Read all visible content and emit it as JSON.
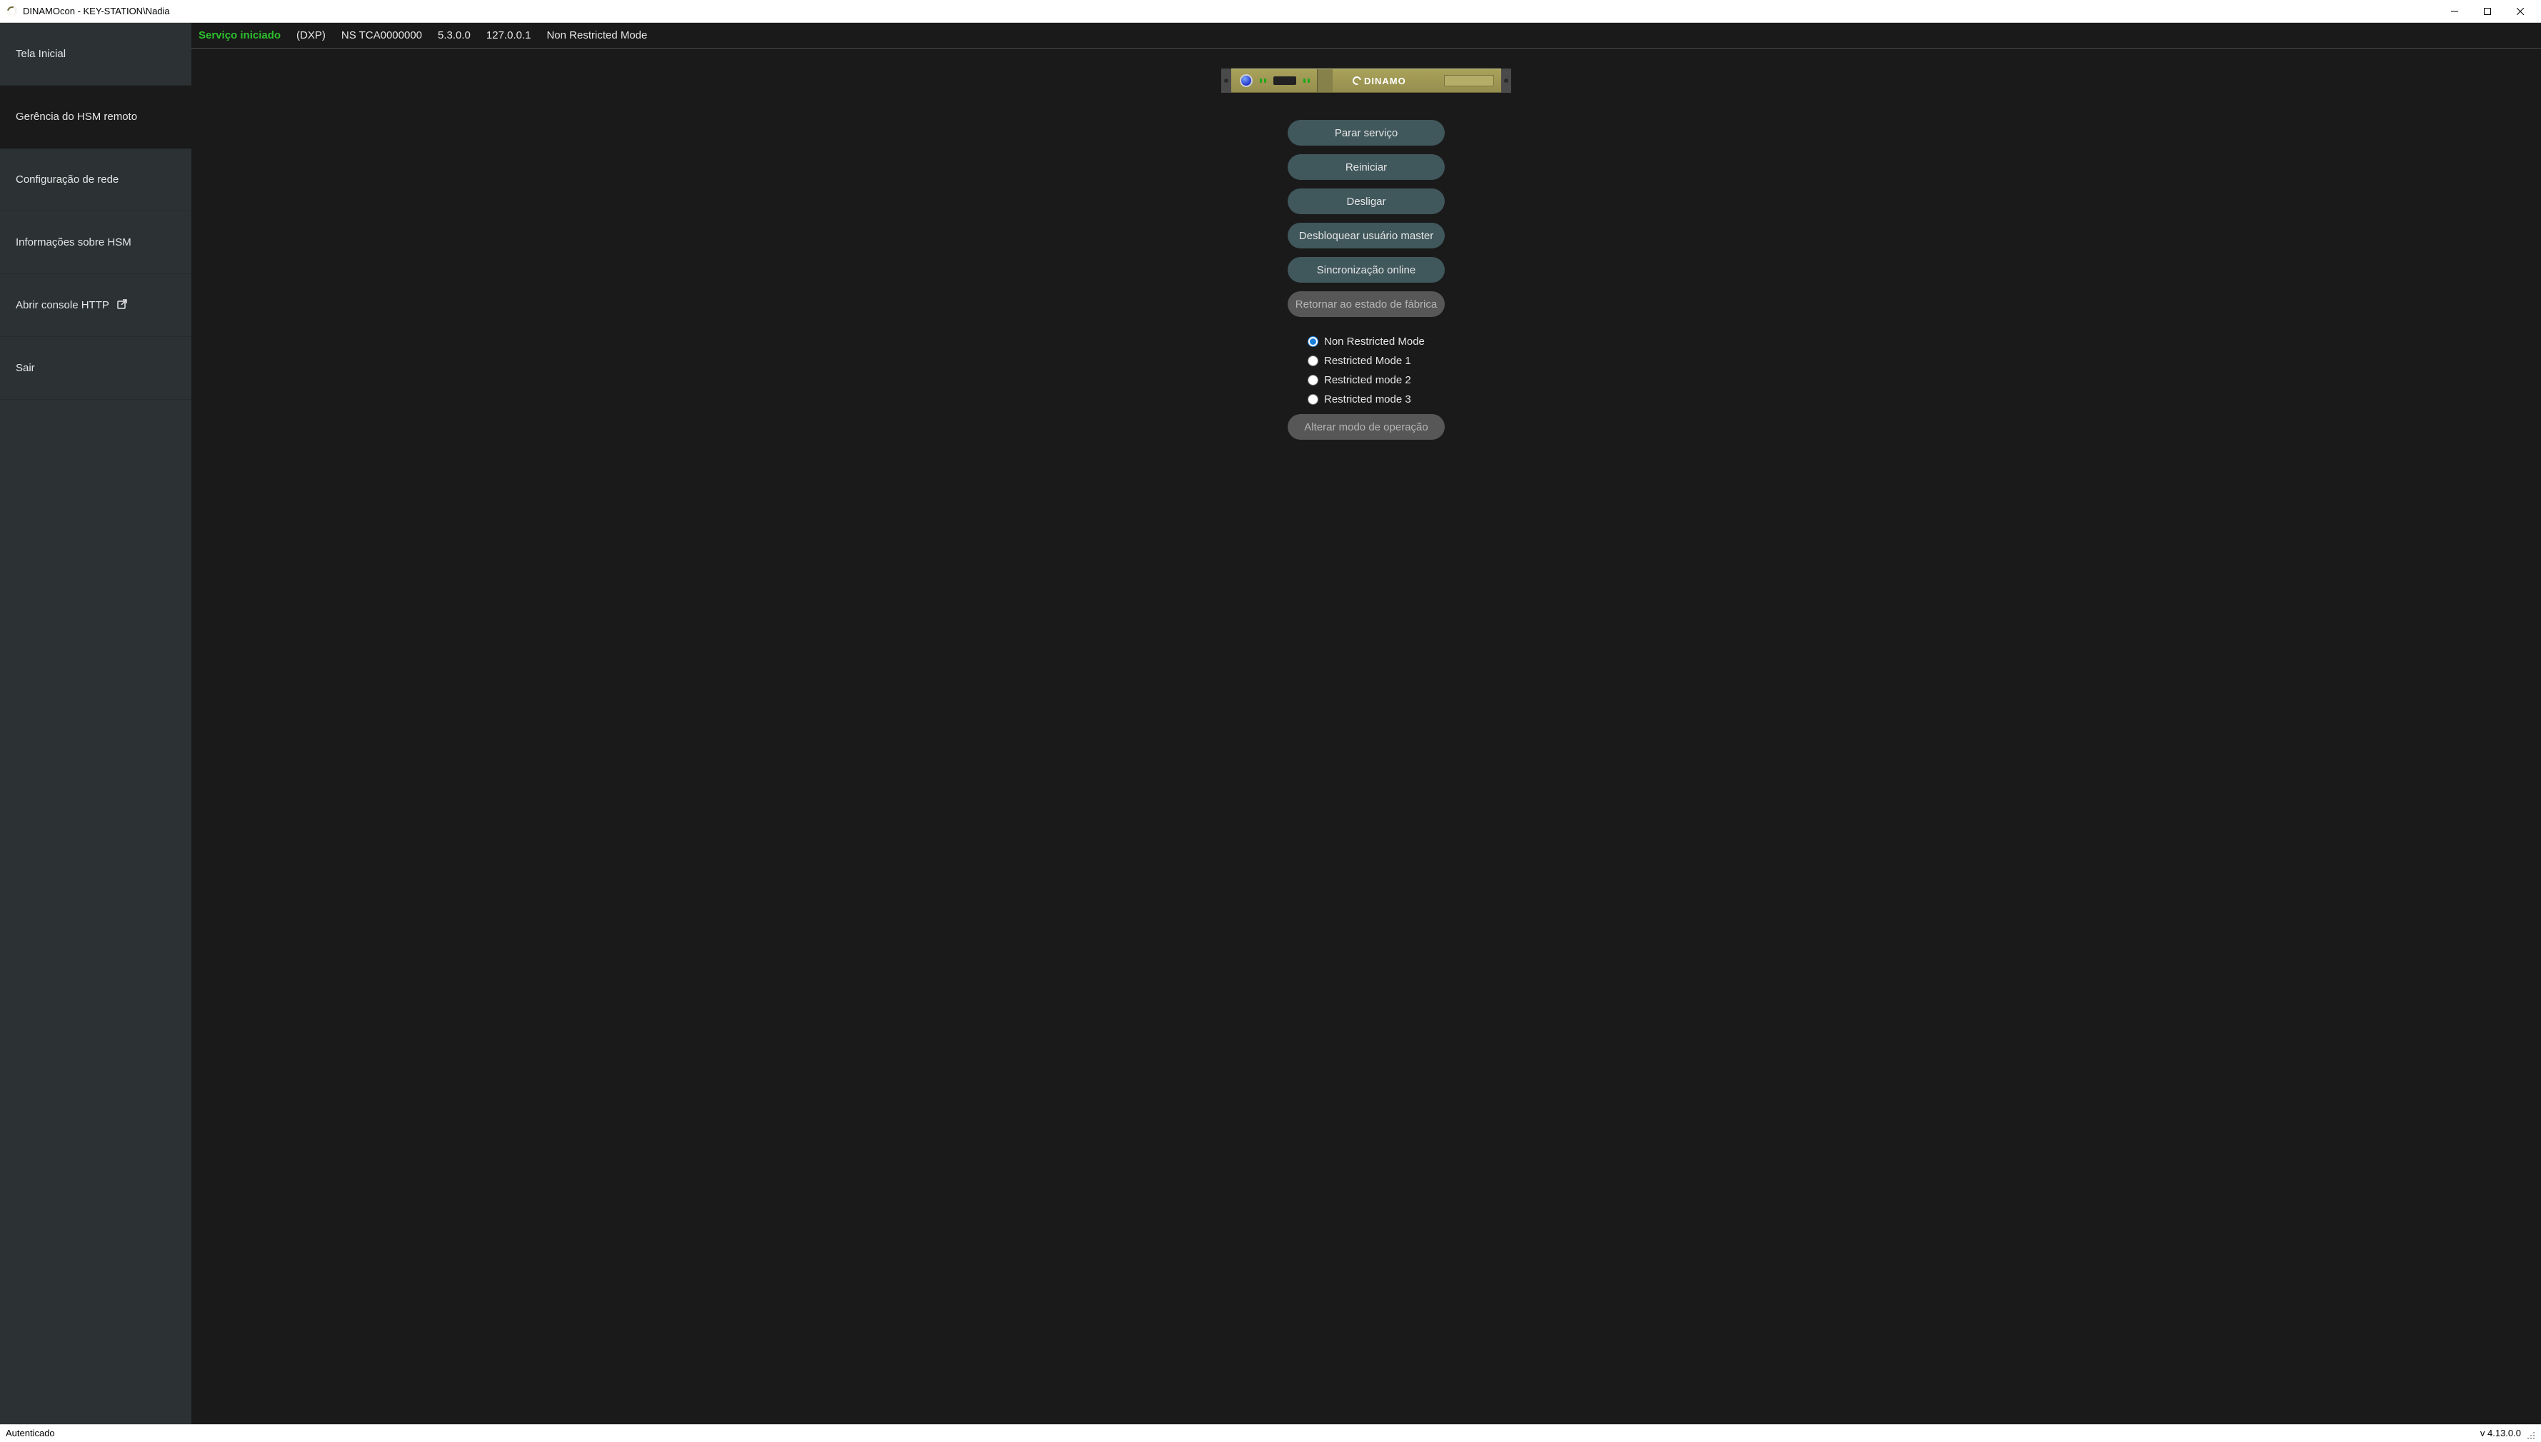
{
  "titlebar": {
    "title": "DINAMOcon - KEY-STATION\\Nadia"
  },
  "sidebar": {
    "items": [
      {
        "label": "Tela Inicial"
      },
      {
        "label": "Gerência do HSM remoto"
      },
      {
        "label": "Configuração de rede"
      },
      {
        "label": "Informações sobre HSM"
      },
      {
        "label": "Abrir console HTTP",
        "external": true
      },
      {
        "label": "Sair"
      }
    ],
    "active_index": 1
  },
  "status": {
    "service_state": "Serviço iniciado",
    "model": "(DXP)",
    "serial": "NS TCA0000000",
    "version": "5.3.0.0",
    "ip": "127.0.0.1",
    "mode": "Non Restricted Mode"
  },
  "device_brand": "DINAMO",
  "actions": {
    "stop": "Parar serviço",
    "restart": "Reiniciar",
    "shutdown": "Desligar",
    "unblock": "Desbloquear usuário master",
    "sync": "Sincronização online",
    "factory": "Retornar ao estado de fábrica",
    "change_mode": "Alterar modo de operação"
  },
  "modes": {
    "options": [
      "Non Restricted Mode",
      "Restricted Mode 1",
      "Restricted mode 2",
      "Restricted mode 3"
    ],
    "selected_index": 0
  },
  "footer": {
    "left": "Autenticado",
    "right": "v 4.13.0.0"
  }
}
